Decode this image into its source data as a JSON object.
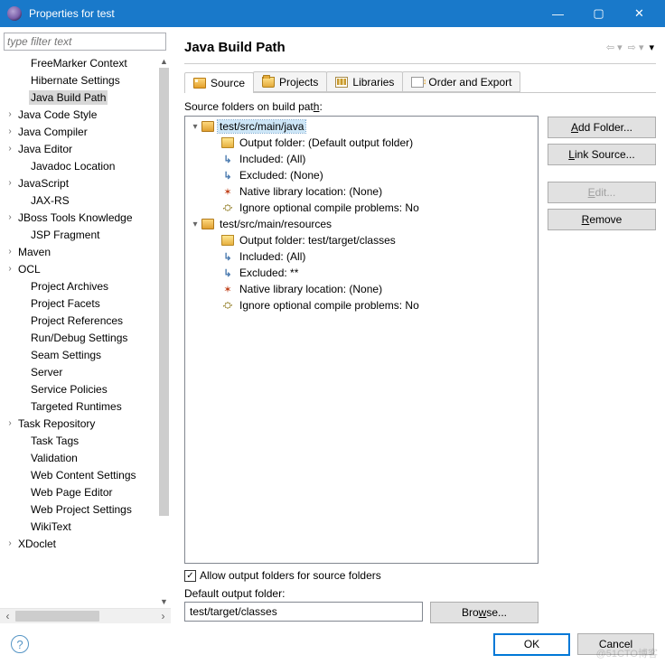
{
  "titlebar": {
    "title": "Properties for test"
  },
  "filter": {
    "placeholder": "type filter text"
  },
  "nav_items": [
    {
      "label": "FreeMarker Context",
      "exp": false,
      "lvl": 1
    },
    {
      "label": "Hibernate Settings",
      "exp": false,
      "lvl": 1
    },
    {
      "label": "Java Build Path",
      "exp": false,
      "lvl": 1,
      "selected": true
    },
    {
      "label": "Java Code Style",
      "exp": true,
      "lvl": 0
    },
    {
      "label": "Java Compiler",
      "exp": true,
      "lvl": 0
    },
    {
      "label": "Java Editor",
      "exp": true,
      "lvl": 0
    },
    {
      "label": "Javadoc Location",
      "exp": false,
      "lvl": 1
    },
    {
      "label": "JavaScript",
      "exp": true,
      "lvl": 0
    },
    {
      "label": "JAX-RS",
      "exp": false,
      "lvl": 1
    },
    {
      "label": "JBoss Tools Knowledge",
      "exp": true,
      "lvl": 0
    },
    {
      "label": "JSP Fragment",
      "exp": false,
      "lvl": 1
    },
    {
      "label": "Maven",
      "exp": true,
      "lvl": 0
    },
    {
      "label": "OCL",
      "exp": true,
      "lvl": 0
    },
    {
      "label": "Project Archives",
      "exp": false,
      "lvl": 1
    },
    {
      "label": "Project Facets",
      "exp": false,
      "lvl": 1
    },
    {
      "label": "Project References",
      "exp": false,
      "lvl": 1
    },
    {
      "label": "Run/Debug Settings",
      "exp": false,
      "lvl": 1
    },
    {
      "label": "Seam Settings",
      "exp": false,
      "lvl": 1
    },
    {
      "label": "Server",
      "exp": false,
      "lvl": 1
    },
    {
      "label": "Service Policies",
      "exp": false,
      "lvl": 1
    },
    {
      "label": "Targeted Runtimes",
      "exp": false,
      "lvl": 1
    },
    {
      "label": "Task Repository",
      "exp": true,
      "lvl": 0
    },
    {
      "label": "Task Tags",
      "exp": false,
      "lvl": 1
    },
    {
      "label": "Validation",
      "exp": false,
      "lvl": 1
    },
    {
      "label": "Web Content Settings",
      "exp": false,
      "lvl": 1
    },
    {
      "label": "Web Page Editor",
      "exp": false,
      "lvl": 1
    },
    {
      "label": "Web Project Settings",
      "exp": false,
      "lvl": 1
    },
    {
      "label": "WikiText",
      "exp": false,
      "lvl": 1
    },
    {
      "label": "XDoclet",
      "exp": true,
      "lvl": 0
    }
  ],
  "page": {
    "title": "Java Build Path",
    "src_label_pre": "Source folders on build pat",
    "src_label_ul": "h",
    "src_label_post": ":",
    "tabs": [
      {
        "label": "Source",
        "icon": "source"
      },
      {
        "label": "Projects",
        "icon": "projects"
      },
      {
        "label": "Libraries",
        "icon": "libraries"
      },
      {
        "label": "Order and Export",
        "icon": "order"
      }
    ],
    "src_tree": [
      {
        "depth": 0,
        "tw": "▾",
        "icon": "pkg",
        "label": "test/src/main/java",
        "selected": true
      },
      {
        "depth": 1,
        "tw": "",
        "icon": "folder",
        "label": "Output folder: (Default output folder)"
      },
      {
        "depth": 1,
        "tw": "",
        "icon": "arrow",
        "label": "Included: (All)"
      },
      {
        "depth": 1,
        "tw": "",
        "icon": "arrow",
        "label": "Excluded: (None)"
      },
      {
        "depth": 1,
        "tw": "",
        "icon": "gear",
        "label": "Native library location: (None)"
      },
      {
        "depth": 1,
        "tw": "",
        "icon": "ignore",
        "label": "Ignore optional compile problems: No"
      },
      {
        "depth": 0,
        "tw": "▾",
        "icon": "pkg",
        "label": "test/src/main/resources"
      },
      {
        "depth": 1,
        "tw": "",
        "icon": "folder",
        "label": "Output folder: test/target/classes"
      },
      {
        "depth": 1,
        "tw": "",
        "icon": "arrow",
        "label": "Included: (All)"
      },
      {
        "depth": 1,
        "tw": "",
        "icon": "arrow",
        "label": "Excluded: **"
      },
      {
        "depth": 1,
        "tw": "",
        "icon": "gear",
        "label": "Native library location: (None)"
      },
      {
        "depth": 1,
        "tw": "",
        "icon": "ignore",
        "label": "Ignore optional compile problems: No"
      }
    ],
    "buttons": {
      "add_folder_pre": "",
      "add_folder_ul": "A",
      "add_folder_post": "dd Folder...",
      "link_source_pre": "",
      "link_source_ul": "L",
      "link_source_post": "ink Source...",
      "edit_pre": "",
      "edit_ul": "E",
      "edit_post": "dit...",
      "remove_pre": "",
      "remove_ul": "R",
      "remove_post": "emove",
      "browse_pre": "Bro",
      "browse_ul": "w",
      "browse_post": "se..."
    },
    "allow_chk": "Allow output folders for source folders",
    "default_out_pre": "Default output folde",
    "default_out_ul": "r",
    "default_out_post": ":",
    "out_value": "test/target/classes"
  },
  "dialog": {
    "ok": "OK",
    "cancel": "Cancel"
  },
  "watermark": "@51CTO博客"
}
